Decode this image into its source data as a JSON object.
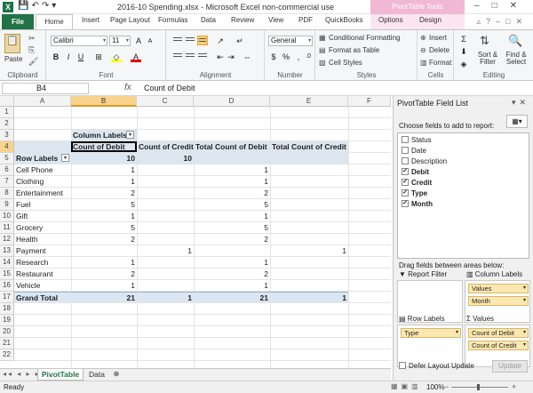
{
  "window": {
    "title": "2016-10 Spending.xlsx - Microsoft Excel non-commercial use",
    "context_tab": "PivotTable Tools",
    "logo_letter": "X"
  },
  "ribbon_tabs": [
    "File",
    "Home",
    "Insert",
    "Page Layout",
    "Formulas",
    "Data",
    "Review",
    "View",
    "PDF",
    "QuickBooks",
    "Options",
    "Design"
  ],
  "ribbon": {
    "paste": "Paste",
    "clipboard": "Clipboard",
    "font_name": "Calibri",
    "font_size": "11",
    "font": "Font",
    "alignment": "Alignment",
    "number_format": "General",
    "number": "Number",
    "conditional_formatting": "Conditional Formatting",
    "format_as_table": "Format as Table",
    "cell_styles": "Cell Styles",
    "styles": "Styles",
    "insert": "Insert",
    "delete": "Delete",
    "format": "Format",
    "cells": "Cells",
    "sort_filter": "Sort & Filter",
    "find_select": "Find & Select",
    "editing": "Editing"
  },
  "formula_bar": {
    "name_box": "B4",
    "fx": "fx",
    "content": "Count of Debit"
  },
  "columns": [
    "A",
    "B",
    "C",
    "D",
    "E",
    "F"
  ],
  "pivot": {
    "column_labels": "Column Labels",
    "headers": [
      "Count of Debit",
      "Count of Credit",
      "Total Count of Debit",
      "Total Count of Credit"
    ],
    "row_labels": "Row Labels",
    "row5": {
      "b": "10",
      "c": "10"
    },
    "rows": [
      {
        "n": "6",
        "label": "Cell Phone",
        "b": "1",
        "c": "",
        "d": "1",
        "e": ""
      },
      {
        "n": "7",
        "label": "Clothing",
        "b": "1",
        "c": "",
        "d": "1",
        "e": ""
      },
      {
        "n": "8",
        "label": "Entertainment",
        "b": "2",
        "c": "",
        "d": "2",
        "e": ""
      },
      {
        "n": "9",
        "label": "Fuel",
        "b": "5",
        "c": "",
        "d": "5",
        "e": ""
      },
      {
        "n": "10",
        "label": "Gift",
        "b": "1",
        "c": "",
        "d": "1",
        "e": ""
      },
      {
        "n": "11",
        "label": "Grocery",
        "b": "5",
        "c": "",
        "d": "5",
        "e": ""
      },
      {
        "n": "12",
        "label": "Health",
        "b": "2",
        "c": "",
        "d": "2",
        "e": ""
      },
      {
        "n": "13",
        "label": "Payment",
        "b": "",
        "c": "1",
        "d": "",
        "e": "1"
      },
      {
        "n": "14",
        "label": "Research",
        "b": "1",
        "c": "",
        "d": "1",
        "e": ""
      },
      {
        "n": "15",
        "label": "Restaurant",
        "b": "2",
        "c": "",
        "d": "2",
        "e": ""
      },
      {
        "n": "16",
        "label": "Vehicle",
        "b": "1",
        "c": "",
        "d": "1",
        "e": ""
      }
    ],
    "grand_total": {
      "n": "17",
      "label": "Grand Total",
      "b": "21",
      "c": "1",
      "d": "21",
      "e": "1"
    },
    "empty_rows": [
      "18",
      "19",
      "20",
      "21",
      "22"
    ]
  },
  "sheet_tabs": [
    "PivotTable",
    "Data"
  ],
  "status": {
    "ready": "Ready",
    "zoom": "100%"
  },
  "field_list": {
    "title": "PivotTable Field List",
    "choose_label": "Choose fields to add to report:",
    "fields": [
      {
        "name": "Status",
        "checked": false
      },
      {
        "name": "Date",
        "checked": false
      },
      {
        "name": "Description",
        "checked": false
      },
      {
        "name": "Debit",
        "checked": true
      },
      {
        "name": "Credit",
        "checked": true
      },
      {
        "name": "Type",
        "checked": true
      },
      {
        "name": "Month",
        "checked": true
      }
    ],
    "drag_label": "Drag fields between areas below:",
    "report_filter": "Report Filter",
    "column_labels": "Column Labels",
    "column_items": [
      "Values",
      "Month"
    ],
    "row_labels": "Row Labels",
    "row_items": [
      "Type"
    ],
    "values": "Values",
    "value_items": [
      "Count of Debit",
      "Count of Credit"
    ],
    "defer": "Defer Layout Update",
    "update": "Update"
  }
}
